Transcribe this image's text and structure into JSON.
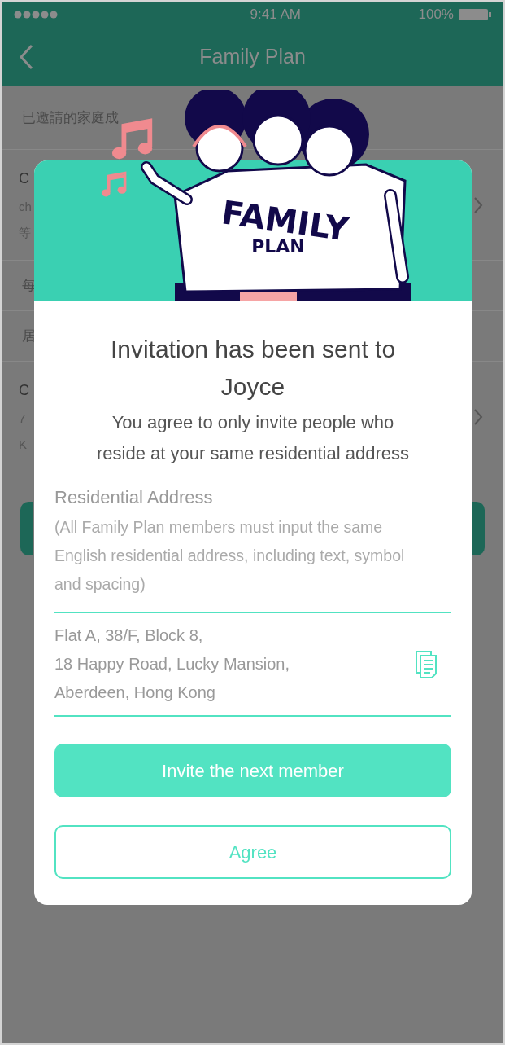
{
  "status_bar": {
    "time": "9:41 AM",
    "battery": "100%"
  },
  "nav": {
    "title": "Family Plan"
  },
  "background": {
    "items": [
      {
        "kind": "header",
        "texts": [
          "已邀請的家庭成"
        ]
      },
      {
        "kind": "row",
        "texts": [
          "C",
          "ch",
          "等"
        ]
      },
      {
        "kind": "header",
        "texts": [
          "每"
        ]
      },
      {
        "kind": "header",
        "texts": [
          "居"
        ]
      },
      {
        "kind": "row",
        "texts": [
          "C",
          "7",
          "K"
        ]
      },
      {
        "kind": "button"
      }
    ]
  },
  "dialog": {
    "illustration": {
      "shirt_text": [
        "FAMILY",
        "PLAN"
      ]
    },
    "title": "Invitation has been sent to Joyce",
    "message": "You agree to only invite people who reside at your same residential address",
    "field": {
      "label": "Residential Address",
      "hint": "(All Family Plan members must input the same English residential address, including text, symbol and spacing)",
      "value": "Flat A, 38/F, Block 8,\n18 Happy Road, Lucky Mansion,\nAberdeen, Hong Kong"
    },
    "buttons": [
      {
        "label": "Invite the next member",
        "kind": "primary"
      },
      {
        "label": "Agree",
        "kind": "outline"
      }
    ]
  }
}
